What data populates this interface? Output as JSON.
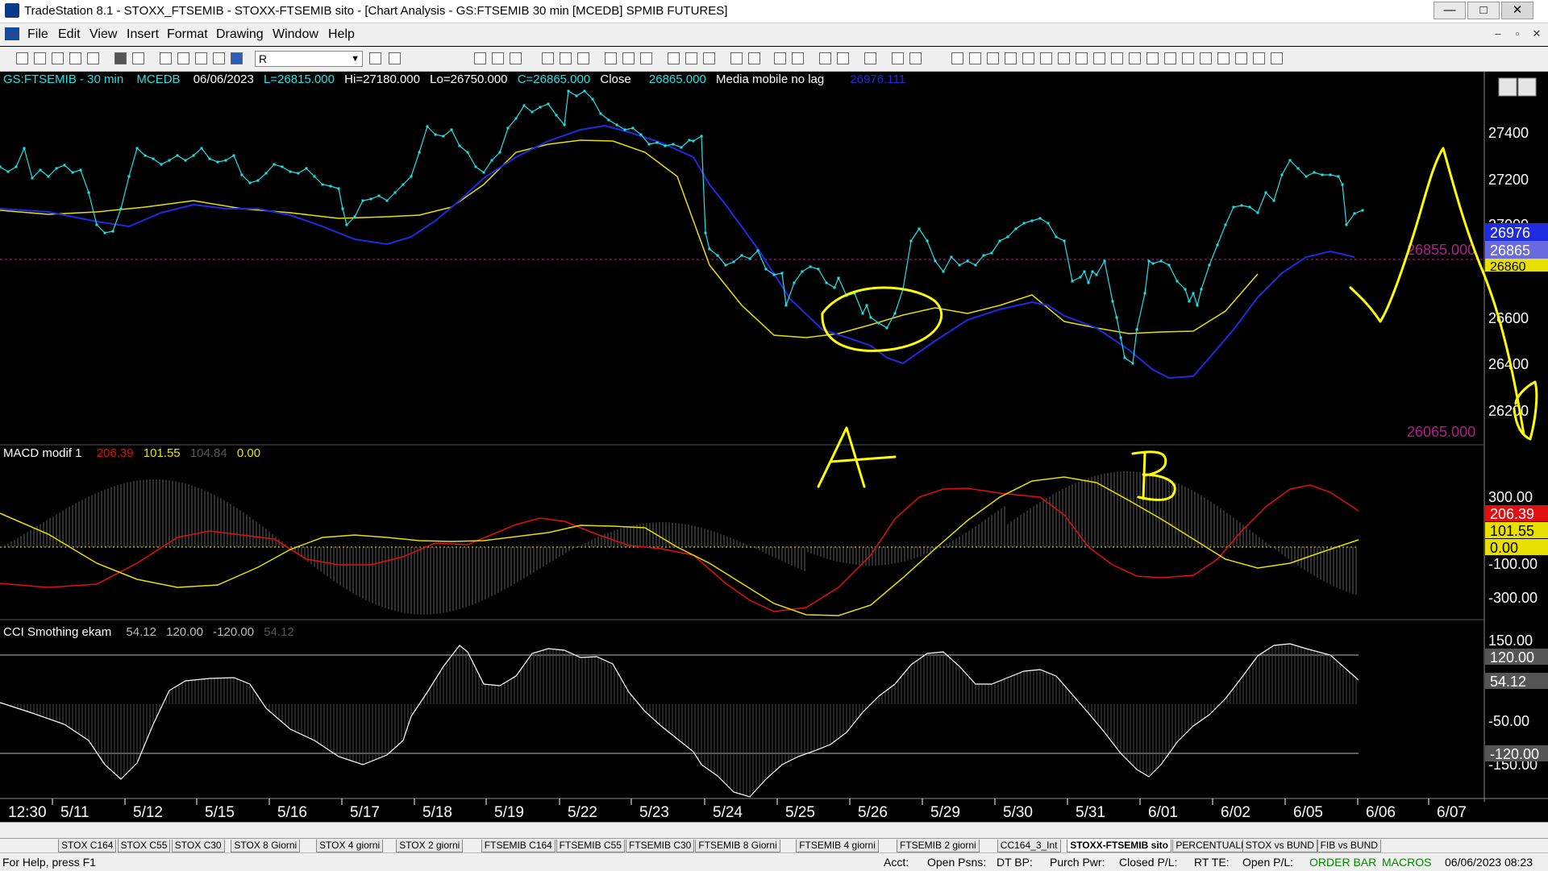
{
  "window": {
    "title": "TradeStation 8.1 - STOXX_FTSEMIB - STOXX-FTSEMIB sito - [Chart Analysis - GS:FTSEMIB  30 min  [MCEDB] SPMIB FUTURES]",
    "min": "—",
    "max": "□",
    "close": "✕"
  },
  "menu": [
    "File",
    "Edit",
    "View",
    "Insert",
    "Format",
    "Drawing",
    "Window",
    "Help"
  ],
  "mdi": {
    "min": "–",
    "restore": "▫",
    "close": "✕"
  },
  "toolbar": {
    "symbol": "R"
  },
  "header": {
    "symbol": "GS:FTSEMIB - 30 min",
    "data": "MCEDB",
    "date": "06/06/2023",
    "L": "L=26815.000",
    "Hi": "Hi=27180.000",
    "Lo": "Lo=26750.000",
    "C": "C=26865.000",
    "closeLabel": "Close",
    "closeVal": "26865.000",
    "maLabel": "Media mobile no lag",
    "maVal": "26976.111"
  },
  "macd": {
    "label": "MACD modif 1",
    "v1": "206.39",
    "v2": "101.55",
    "v3": "104.84",
    "v4": "0.00"
  },
  "cci": {
    "label": "CCI Smothing ekam",
    "v1": "54.12",
    "v2": "120.00",
    "v3": "-120.00",
    "v4": "54.12"
  },
  "priceTicks": [
    "27400",
    "27200",
    "27000",
    "26600",
    "26400",
    "26200"
  ],
  "priceMarkers": {
    "blue": "26976",
    "mag": "26865",
    "yellow": "26860",
    "ref1": "26855.000",
    "ref2": "26065.000"
  },
  "macdTicks": [
    "300.00",
    "-100.00",
    "-300.00"
  ],
  "macdMarkers": {
    "red": "206.39",
    "yellow": "101.55",
    "zero": "0.00"
  },
  "cciTicks": [
    "150.00",
    "-50.00",
    "-150.00"
  ],
  "cciMarkers": {
    "up": "120.00",
    "val": "54.12",
    "down": "-120.00"
  },
  "dates": [
    "12:30",
    "5/11",
    "5/12",
    "5/15",
    "5/16",
    "5/17",
    "5/18",
    "5/19",
    "5/22",
    "5/23",
    "5/24",
    "5/25",
    "5/26",
    "5/29",
    "5/30",
    "5/31",
    "6/01",
    "6/02",
    "6/05",
    "6/06",
    "6/07"
  ],
  "annotations": {
    "a": "A",
    "b": "B"
  },
  "tabs": [
    "STOX C164",
    "STOX C55",
    "STOX  C30",
    "STOX  8 Giorni",
    "STOX 4 giorni",
    "STOX  2 giorni",
    "FTSEMIB C164",
    "FTSEMIB C55",
    "FTSEMIB C30",
    "FTSEMIB  8 Giorni",
    "FTSEMIB  4 giorni",
    "FTSEMIB  2 giorni",
    "CC164_3_Int",
    "STOXX-FTSEMIB sito",
    "PERCENTUALE",
    "STOX vs BUND",
    "FIB vs BUND"
  ],
  "status": {
    "help": "For Help, press F1",
    "acct": "Acct:",
    "openPsns": "Open Psns:",
    "dtbp": "DT BP:",
    "purch": "Purch Pwr:",
    "closedpl": "Closed P/L:",
    "rtte": "RT TE:",
    "openpl": "Open P/L:",
    "orderbar": "ORDER BAR",
    "macros": "MACROS",
    "datetime": "06/06/2023 08:23"
  },
  "colors": {
    "cyan": "#1ee3e8",
    "blueMA": "#1f2be0",
    "yellowMA": "#e8e000",
    "red": "#e01010",
    "magenta": "#b0208a",
    "annot": "#ffff00"
  }
}
